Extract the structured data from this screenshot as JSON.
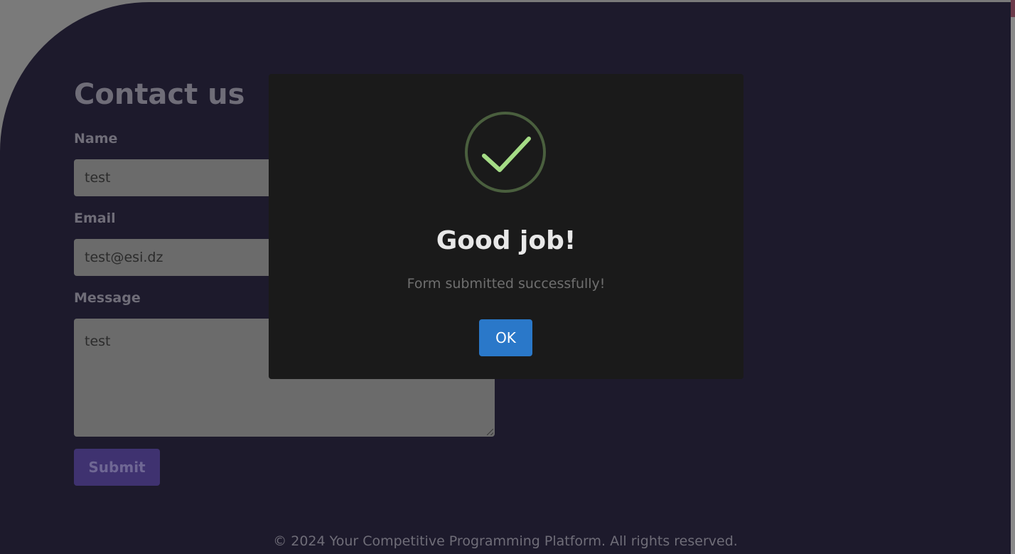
{
  "contact": {
    "title": "Contact us",
    "name_label": "Name",
    "name_value": "test",
    "email_label": "Email",
    "email_value": "test@esi.dz",
    "message_label": "Message",
    "message_value": "test",
    "submit_label": "Submit"
  },
  "footer": {
    "text": "© 2024 Your Competitive Programming Platform. All rights reserved."
  },
  "modal": {
    "icon": "success-check-icon",
    "title": "Good job!",
    "text": "Form submitted successfully!",
    "ok_label": "OK"
  },
  "colors": {
    "background": "#1d1a2c",
    "accent": "#2a78c9",
    "success": "#a5dc86",
    "submit": "#3f3270"
  }
}
